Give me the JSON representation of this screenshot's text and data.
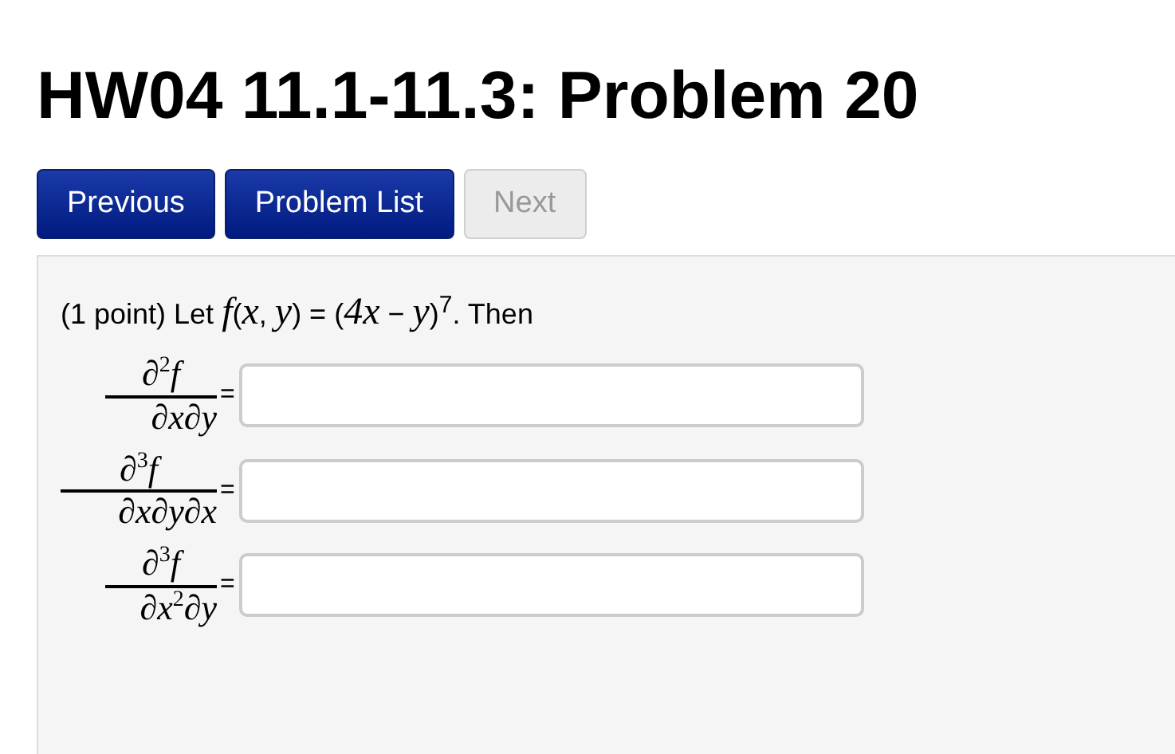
{
  "title": "HW04 11.1-11.3: Problem 20",
  "nav_buttons": [
    {
      "label": "Previous",
      "disabled": false
    },
    {
      "label": "Problem List",
      "disabled": false
    },
    {
      "label": "Next",
      "disabled": true
    }
  ],
  "problem": {
    "intro": "(1 point) Let *f*(*x*, *y*) = (*4x* − *y*)$^{7}$. Then",
    "answers": [
      {
        "numerator": "∂$^{2}$*f*",
        "denominator": "∂*x*∂*y*",
        "equals": "="
      },
      {
        "numerator": "∂$^{3}$*f*",
        "denominator": "∂*x*∂*y*∂*x*",
        "equals": "="
      },
      {
        "numerator": "∂$^{3}$*f*",
        "denominator": "∂*x*$^{2}$∂*y*",
        "equals": "="
      }
    ]
  }
}
